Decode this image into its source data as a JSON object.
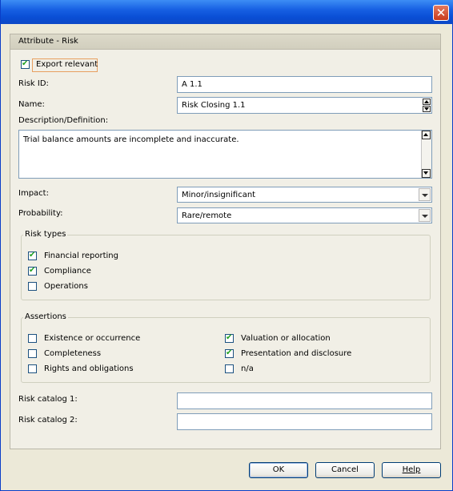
{
  "title_bar": {
    "close_icon": "close-icon"
  },
  "panel": {
    "title": "Attribute - Risk"
  },
  "form": {
    "export_relevant": {
      "label": "Export relevant",
      "checked": true
    },
    "risk_id": {
      "label": "Risk ID:",
      "value": "A 1.1"
    },
    "name": {
      "label": "Name:",
      "value": "Risk Closing 1.1"
    },
    "description": {
      "label": "Description/Definition:",
      "value": "Trial balance amounts are incomplete and inaccurate."
    },
    "impact": {
      "label": "Impact:",
      "value": "Minor/insignificant"
    },
    "probability": {
      "label": "Probability:",
      "value": "Rare/remote"
    },
    "risk_types": {
      "title": "Risk types",
      "items": [
        {
          "label": "Financial reporting",
          "checked": true
        },
        {
          "label": "Compliance",
          "checked": true
        },
        {
          "label": "Operations",
          "checked": false
        }
      ]
    },
    "assertions": {
      "title": "Assertions",
      "left": [
        {
          "label": "Existence or occurrence",
          "checked": false
        },
        {
          "label": "Completeness",
          "checked": false
        },
        {
          "label": "Rights and obligations",
          "checked": false
        }
      ],
      "right": [
        {
          "label": "Valuation or allocation",
          "checked": true
        },
        {
          "label": "Presentation and disclosure",
          "checked": true
        },
        {
          "label": "n/a",
          "checked": false
        }
      ]
    },
    "risk_catalog_1": {
      "label": "Risk catalog 1:",
      "value": ""
    },
    "risk_catalog_2": {
      "label": "Risk catalog 2:",
      "value": ""
    }
  },
  "buttons": {
    "ok": "OK",
    "cancel": "Cancel",
    "help": "Help"
  }
}
